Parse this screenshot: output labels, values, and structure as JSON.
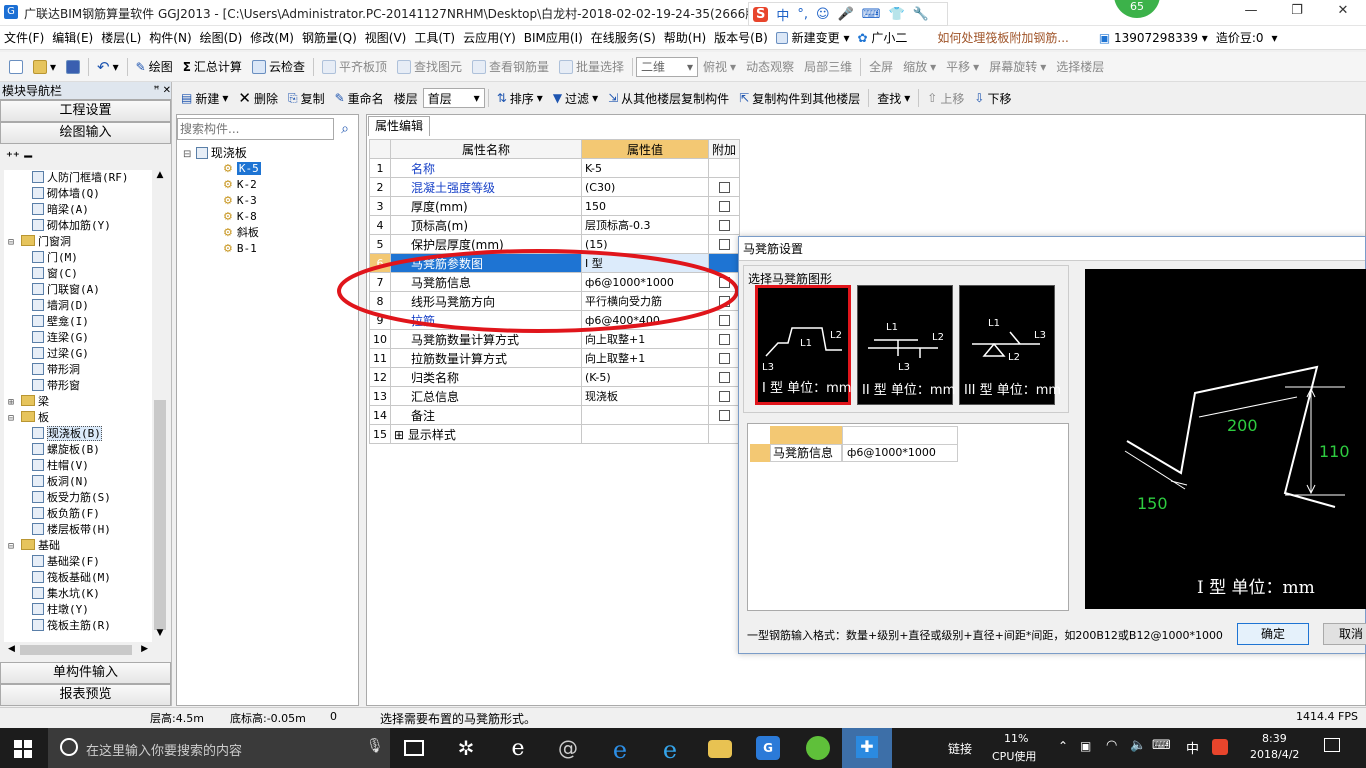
{
  "window": {
    "title": "广联达BIM钢筋算量软件 GGJ2013 - [C:\\Users\\Administrator.PC-20141127NRHM\\Desktop\\白龙村-2018-02-02-19-24-35(2666版",
    "controls": [
      "—",
      "❐",
      "✕"
    ]
  },
  "ime_badge": "65",
  "ime_bar": [
    "S",
    "中",
    "°,",
    "☺",
    "🎤",
    "⌨",
    "👕",
    "🔧"
  ],
  "menu": {
    "items": [
      "文件(F)",
      "编辑(E)",
      "楼层(L)",
      "构件(N)",
      "绘图(D)",
      "修改(M)",
      "钢筋量(Q)",
      "视图(V)",
      "工具(T)",
      "云应用(Y)",
      "BIM应用(I)",
      "在线服务(S)",
      "帮助(H)",
      "版本号(B)"
    ],
    "new_change": "新建变更",
    "assistant": "广小二",
    "question": "如何处理筏板附加钢筋...",
    "phone": "13907298339",
    "price": "造价豆:0"
  },
  "toolbar1": {
    "items": [
      "绘图",
      "汇总计算",
      "云检查",
      "平齐板顶",
      "查找图元",
      "查看钢筋量",
      "批量选择"
    ],
    "view_mode": "二维",
    "items2": [
      "俯视",
      "动态观察",
      "局部三维",
      "全屏",
      "缩放",
      "平移",
      "屏幕旋转",
      "选择楼层"
    ]
  },
  "navigator": {
    "title": "模块导航栏",
    "pin": "ꟸ ✕",
    "btn_project": "工程设置",
    "btn_draw": "绘图输入",
    "tree": [
      {
        "label": "人防门框墙(RF)",
        "type": "item",
        "indent": 2
      },
      {
        "label": "砌体墙(Q)",
        "type": "item",
        "indent": 2
      },
      {
        "label": "暗梁(A)",
        "type": "item",
        "indent": 2
      },
      {
        "label": "砌体加筋(Y)",
        "type": "item",
        "indent": 2
      },
      {
        "label": "门窗洞",
        "type": "folder",
        "indent": 1,
        "expand": "−"
      },
      {
        "label": "门(M)",
        "type": "item",
        "indent": 2
      },
      {
        "label": "窗(C)",
        "type": "item",
        "indent": 2
      },
      {
        "label": "门联窗(A)",
        "type": "item",
        "indent": 2
      },
      {
        "label": "墙洞(D)",
        "type": "item",
        "indent": 2
      },
      {
        "label": "壁龛(I)",
        "type": "item",
        "indent": 2
      },
      {
        "label": "连梁(G)",
        "type": "item",
        "indent": 2
      },
      {
        "label": "过梁(G)",
        "type": "item",
        "indent": 2
      },
      {
        "label": "带形洞",
        "type": "item",
        "indent": 2
      },
      {
        "label": "带形窗",
        "type": "item",
        "indent": 2
      },
      {
        "label": "梁",
        "type": "folder",
        "indent": 1,
        "expand": "+"
      },
      {
        "label": "板",
        "type": "folder",
        "indent": 1,
        "expand": "−"
      },
      {
        "label": "现浇板(B)",
        "type": "item",
        "indent": 2,
        "selected": true
      },
      {
        "label": "螺旋板(B)",
        "type": "item",
        "indent": 2
      },
      {
        "label": "柱帽(V)",
        "type": "item",
        "indent": 2
      },
      {
        "label": "板洞(N)",
        "type": "item",
        "indent": 2
      },
      {
        "label": "板受力筋(S)",
        "type": "item",
        "indent": 2
      },
      {
        "label": "板负筋(F)",
        "type": "item",
        "indent": 2
      },
      {
        "label": "楼层板带(H)",
        "type": "item",
        "indent": 2
      },
      {
        "label": "基础",
        "type": "folder",
        "indent": 1,
        "expand": "−"
      },
      {
        "label": "基础梁(F)",
        "type": "item",
        "indent": 2
      },
      {
        "label": "筏板基础(M)",
        "type": "item",
        "indent": 2
      },
      {
        "label": "集水坑(K)",
        "type": "item",
        "indent": 2
      },
      {
        "label": "柱墩(Y)",
        "type": "item",
        "indent": 2
      },
      {
        "label": "筏板主筋(R)",
        "type": "item",
        "indent": 2
      }
    ],
    "btn_single": "单构件输入",
    "btn_report": "报表预览"
  },
  "toolbar2": {
    "new": "新建",
    "delete": "删除",
    "copy": "复制",
    "rename": "重命名",
    "floor_label": "楼层",
    "floor_value": "首层",
    "sort": "排序",
    "filter": "过滤",
    "copy_from": "从其他楼层复制构件",
    "copy_to": "复制构件到其他楼层",
    "find": "查找",
    "up": "上移",
    "down": "下移"
  },
  "component_list": {
    "search_placeholder": "搜索构件...",
    "root": "现浇板",
    "items": [
      "K-5",
      "K-2",
      "K-3",
      "K-8",
      "斜板",
      "B-1"
    ]
  },
  "property_editor": {
    "tab": "属性编辑",
    "headers": [
      "属性名称",
      "属性值",
      "附加"
    ],
    "rows": [
      {
        "no": "1",
        "name": "名称",
        "value": "K-5",
        "blue": true,
        "check": false
      },
      {
        "no": "2",
        "name": "混凝土强度等级",
        "value": "(C30)",
        "blue": true,
        "check": true
      },
      {
        "no": "3",
        "name": "厚度(mm)",
        "value": "150",
        "blue": false,
        "check": true
      },
      {
        "no": "4",
        "name": "顶标高(m)",
        "value": "层顶标高-0.3",
        "blue": false,
        "check": true
      },
      {
        "no": "5",
        "name": "保护层厚度(mm)",
        "value": "(15)",
        "blue": false,
        "check": true
      },
      {
        "no": "6",
        "name": "马凳筋参数图",
        "value": "I 型",
        "blue": false,
        "check": false,
        "selected": true
      },
      {
        "no": "7",
        "name": "马凳筋信息",
        "value": "ф6@1000*1000",
        "blue": false,
        "check": true
      },
      {
        "no": "8",
        "name": "线形马凳筋方向",
        "value": "平行横向受力筋",
        "blue": false,
        "check": true
      },
      {
        "no": "9",
        "name": "拉筋",
        "value": "ф6@400*400",
        "blue": true,
        "check": true
      },
      {
        "no": "10",
        "name": "马凳筋数量计算方式",
        "value": "向上取整+1",
        "blue": false,
        "check": true
      },
      {
        "no": "11",
        "name": "拉筋数量计算方式",
        "value": "向上取整+1",
        "blue": false,
        "check": true
      },
      {
        "no": "12",
        "name": "归类名称",
        "value": "(K-5)",
        "blue": false,
        "check": true
      },
      {
        "no": "13",
        "name": "汇总信息",
        "value": "现浇板",
        "blue": false,
        "check": true
      },
      {
        "no": "14",
        "name": "备注",
        "value": "",
        "blue": false,
        "check": true
      },
      {
        "no": "15",
        "name": "显示样式",
        "value": "",
        "blue": false,
        "check": false,
        "expander": true
      }
    ]
  },
  "dialog": {
    "title": "马凳筋设置",
    "choose_label": "选择马凳筋图形",
    "shapes": [
      {
        "caption": "I 型 单位：mm",
        "l1": "L1",
        "l2": "L2",
        "l3": "L3"
      },
      {
        "caption": "II 型 单位：mm",
        "l1": "L1",
        "l2": "L2",
        "l3": "L3"
      },
      {
        "caption": "III 型 单位：mm",
        "l1": "L1",
        "l2": "L2",
        "l3": "L3"
      }
    ],
    "grid_label": "马凳筋信息",
    "grid_value": "ф6@1000*1000",
    "preview": {
      "dim1": "200",
      "dim2": "110",
      "dim3": "150",
      "caption": "I 型 单位：mm"
    },
    "hint": "一型钢筋输入格式：数量+级别+直径或级别+直径+间距*间距，如200B12或B12@1000*1000",
    "ok": "确定",
    "cancel": "取消"
  },
  "status": {
    "floor_height": "层高:4.5m",
    "base_elev": "底标高:-0.05m",
    "zero": "0",
    "message": "选择需要布置的马凳筋形式。",
    "fps": "1414.4 FPS"
  },
  "taskbar": {
    "search": "在这里输入你要搜索的内容",
    "link": "链接",
    "cpu_pct": "11%",
    "cpu_label": "CPU使用",
    "lang": "中",
    "time": "8:39",
    "date": "2018/4/2"
  },
  "colors": {
    "selection": "#1e74d3",
    "header_value": "#f3c873",
    "ellipse": "#e0151b",
    "dialog_dims": "#2ecc40"
  }
}
